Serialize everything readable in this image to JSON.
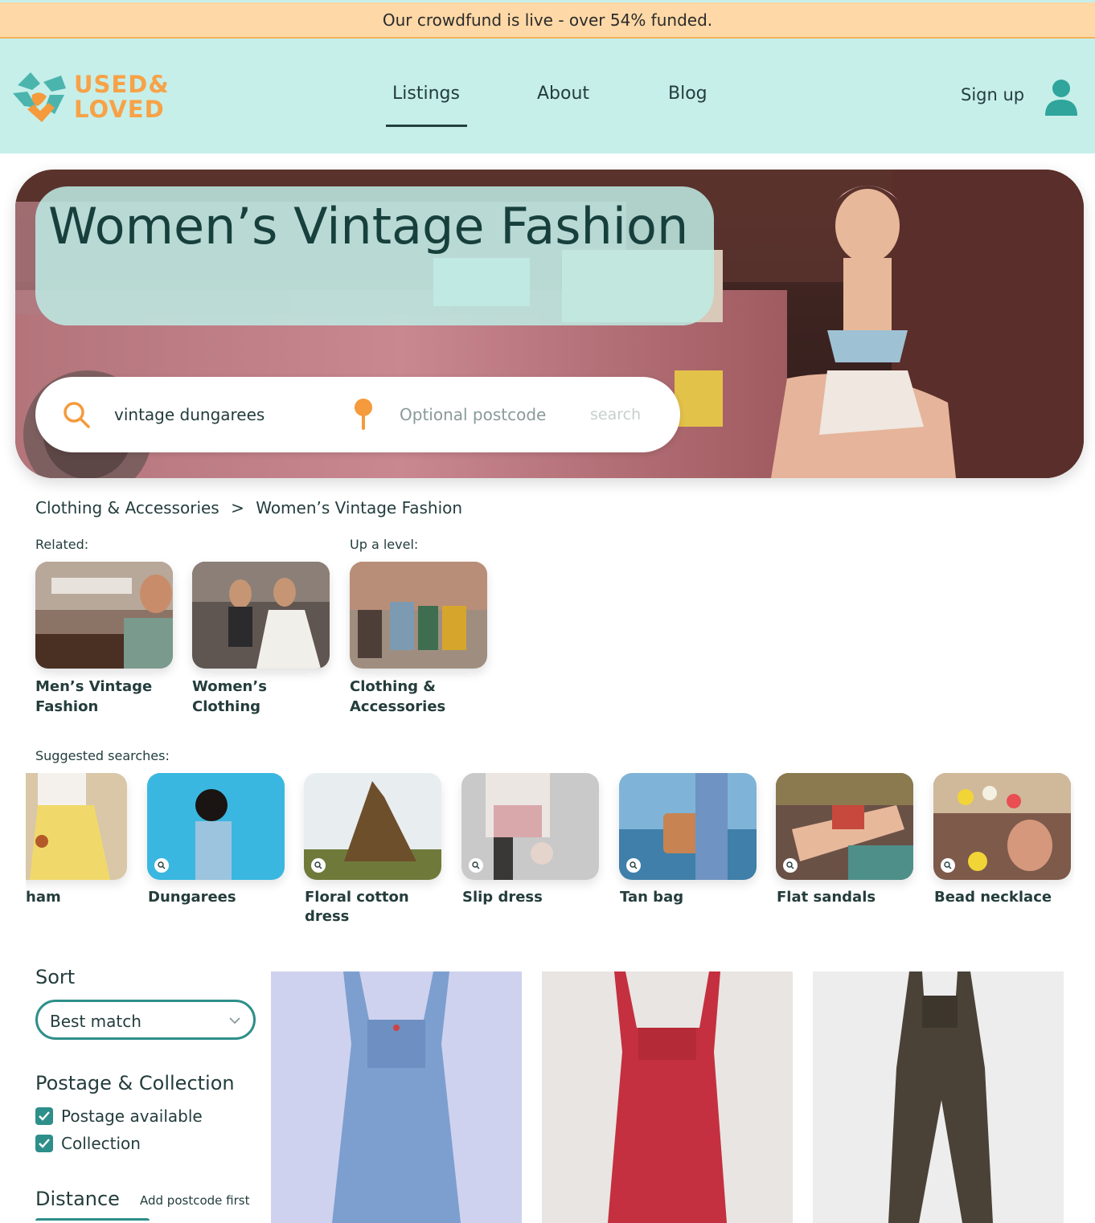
{
  "banner": {
    "text": "Our crowdfund is live - over 54% funded."
  },
  "logo": {
    "line1": "USED&",
    "line2": "LOVED"
  },
  "nav": {
    "items": [
      {
        "label": "Listings",
        "active": true
      },
      {
        "label": "About",
        "active": false
      },
      {
        "label": "Blog",
        "active": false
      }
    ],
    "signup": "Sign up"
  },
  "hero": {
    "title": "Women’s Vintage Fashion",
    "search_value": "vintage dungarees",
    "postcode_placeholder": "Optional postcode",
    "search_button": "search"
  },
  "breadcrumb": {
    "items": [
      "Clothing & Accessories",
      ">",
      "Women’s Vintage Fashion"
    ]
  },
  "related": {
    "label": "Related:",
    "items": [
      "Men’s Vintage Fashion",
      "Women’s Clothing"
    ]
  },
  "up_level": {
    "label": "Up a level:",
    "item": "Clothing & Accessories"
  },
  "suggested": {
    "label": "Suggested searches:",
    "items": [
      "ham",
      "Dungarees",
      "Floral cotton dress",
      "Slip dress",
      "Tan bag",
      "Flat sandals",
      "Bead necklace"
    ]
  },
  "sidebar": {
    "sort_title": "Sort",
    "sort_value": "Best match",
    "postage_title": "Postage & Collection",
    "checkboxes": [
      {
        "label": "Postage available",
        "checked": true
      },
      {
        "label": "Collection",
        "checked": true
      }
    ],
    "distance_title": "Distance",
    "distance_note": "Add postcode first"
  },
  "listings": [
    {
      "color": "blue denim"
    },
    {
      "color": "red"
    },
    {
      "color": "dark brown"
    }
  ],
  "colors": {
    "banner": "#fed8a6",
    "header": "#c6efea",
    "accent": "#2e8f8a",
    "orange": "#f7a247",
    "text": "#243d3c"
  }
}
